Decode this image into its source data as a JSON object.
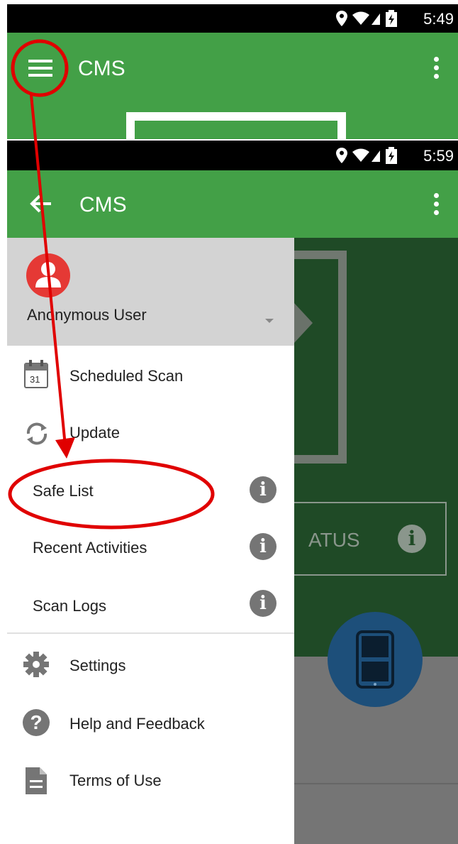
{
  "back_screen": {
    "status_time": "5:49",
    "title": "CMS"
  },
  "front_screen": {
    "status_time": "5:59",
    "title": "CMS",
    "background_status_text": "ATUS"
  },
  "drawer": {
    "user_name": "Anonymous User",
    "calendar_day": "31",
    "items_top": [
      {
        "label": "Scheduled Scan",
        "icon": "calendar-icon"
      },
      {
        "label": "Update",
        "icon": "refresh-icon"
      }
    ],
    "items_info": [
      {
        "label": "Safe List"
      },
      {
        "label": "Recent Activities"
      },
      {
        "label": "Scan Logs"
      }
    ],
    "items_bottom": [
      {
        "label": "Settings",
        "icon": "gear-icon"
      },
      {
        "label": "Help and Feedback",
        "icon": "help-icon"
      },
      {
        "label": "Terms of Use",
        "icon": "document-icon"
      }
    ]
  },
  "colors": {
    "appbar": "#43a047",
    "dark_panel": "#1f4a26",
    "annotation": "#e00000",
    "fab": "#1565c0"
  }
}
